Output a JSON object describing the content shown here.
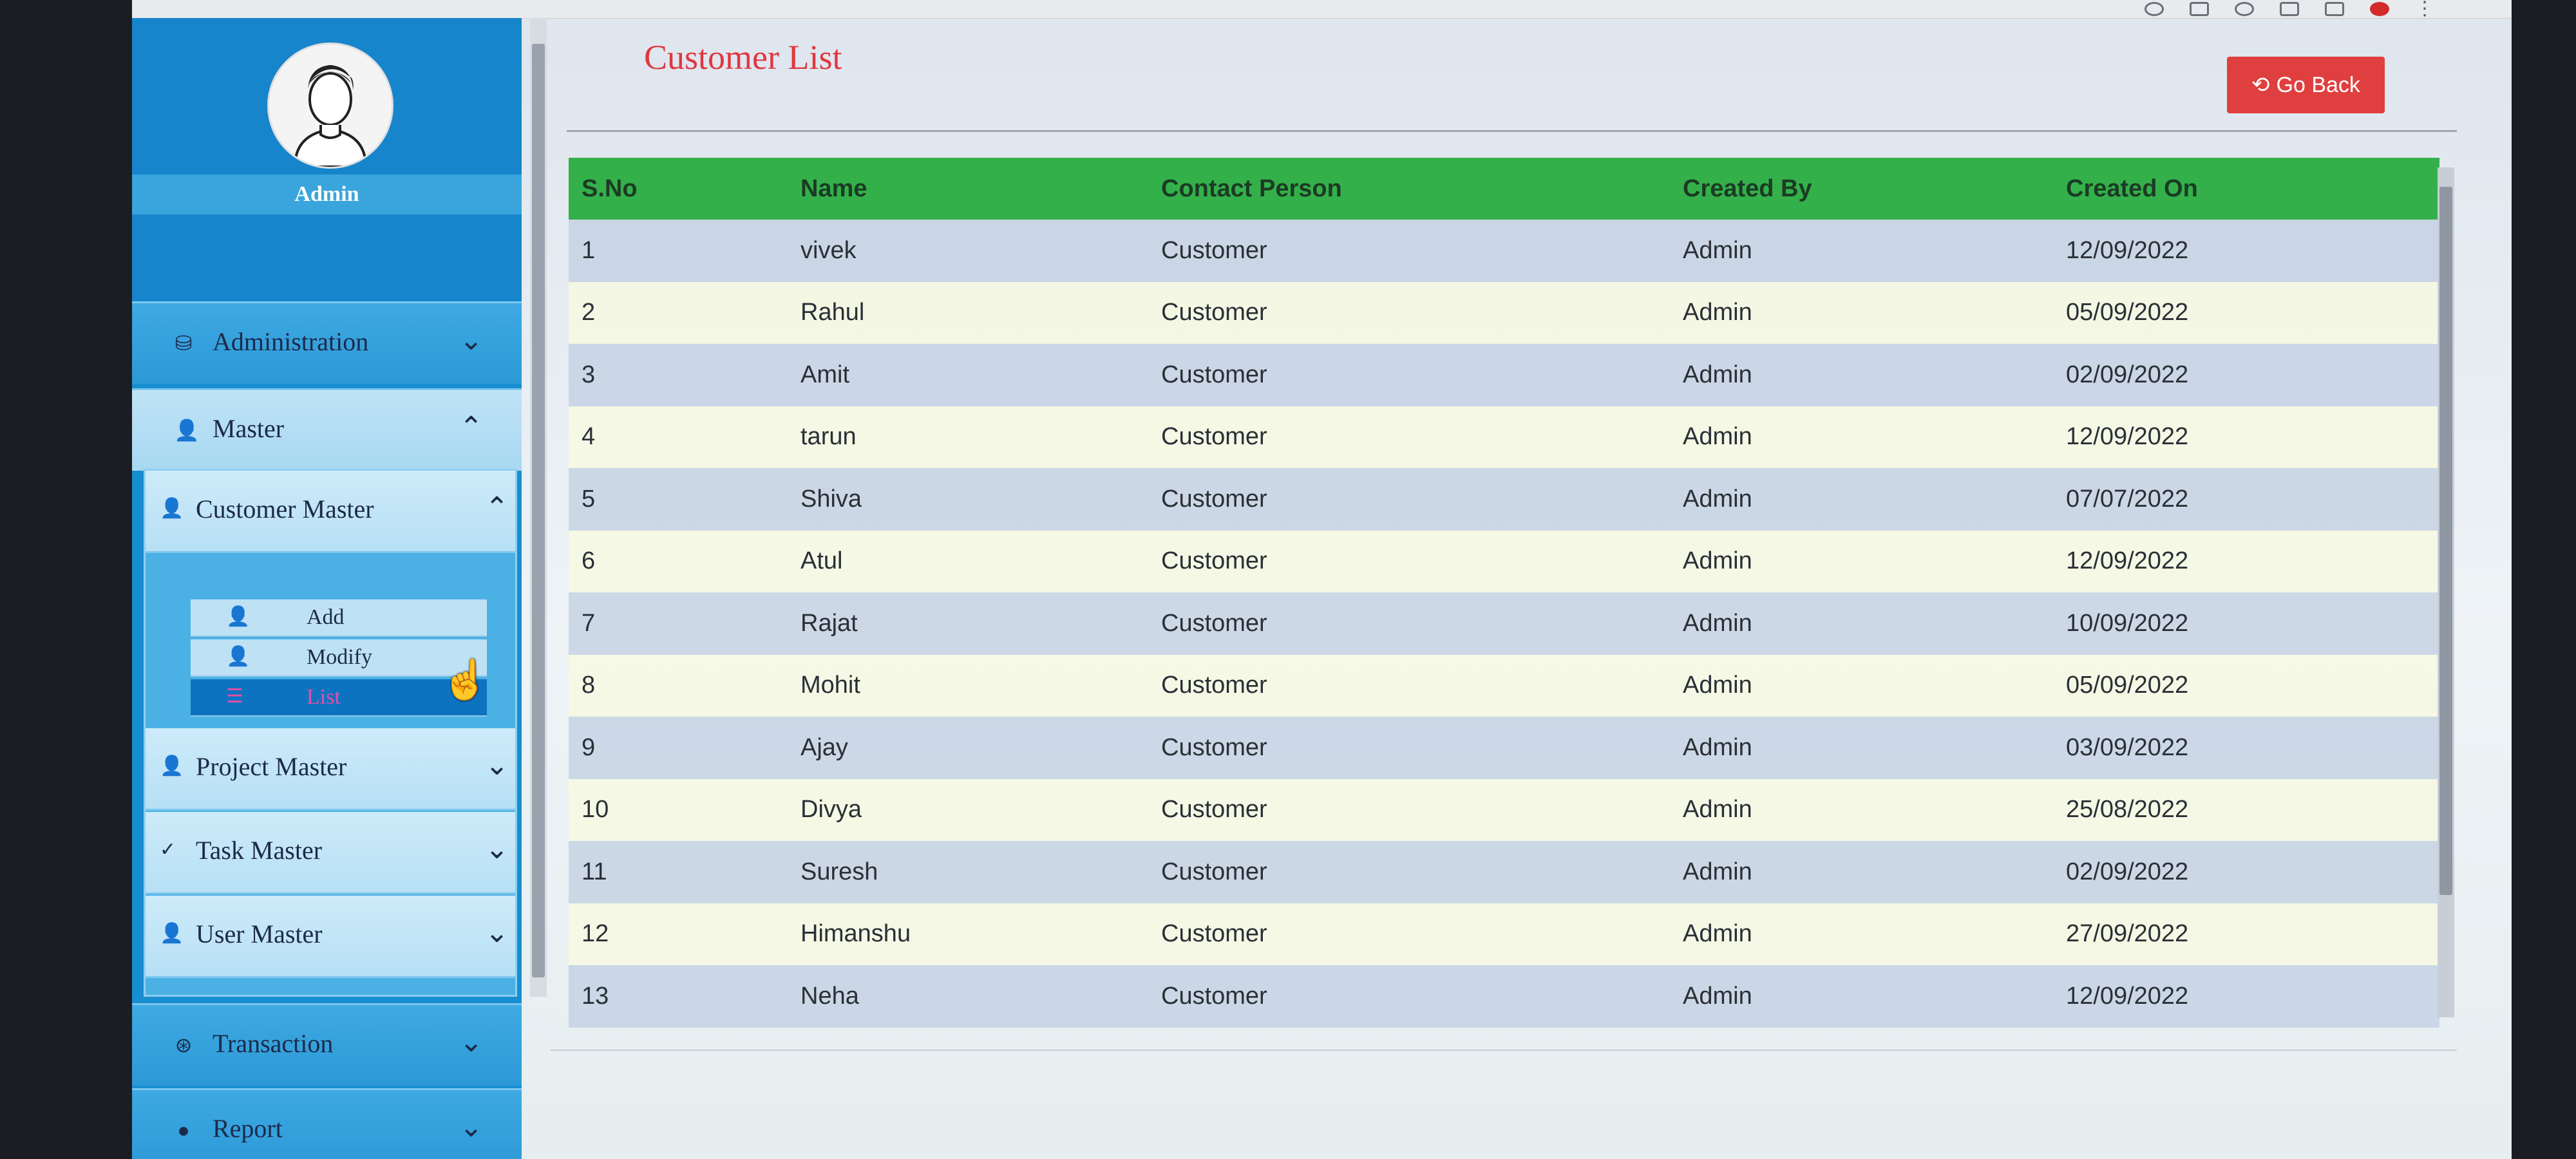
{
  "sidebar": {
    "user_name": "Admin",
    "nav": [
      {
        "label": "Administration",
        "icon": "database-icon",
        "expanded": false
      },
      {
        "label": "Master",
        "icon": "user-icon",
        "expanded": true
      },
      {
        "label": "Transaction",
        "icon": "transaction-icon",
        "expanded": false
      },
      {
        "label": "Report",
        "icon": "alert-icon",
        "expanded": false
      }
    ],
    "master_sub": [
      {
        "label": "Customer Master",
        "expanded": true
      },
      {
        "label": "Project Master",
        "expanded": false
      },
      {
        "label": "Task Master",
        "expanded": false
      },
      {
        "label": "User Master",
        "expanded": false
      }
    ],
    "customer_master_items": [
      {
        "label": "Add",
        "icon": "user-add-icon"
      },
      {
        "label": "Modify",
        "icon": "user-edit-icon"
      },
      {
        "label": "List",
        "icon": "list-icon",
        "active": true
      }
    ]
  },
  "main": {
    "title": "Customer List",
    "go_back_label": "Go Back",
    "table": {
      "headers": [
        "S.No",
        "Name",
        "Contact Person",
        "Created By",
        "Created On"
      ],
      "rows": [
        [
          "1",
          "vivek",
          "Customer",
          "Admin",
          "12/09/2022"
        ],
        [
          "2",
          "Rahul",
          "Customer",
          "Admin",
          "05/09/2022"
        ],
        [
          "3",
          "Amit",
          "Customer",
          "Admin",
          "02/09/2022"
        ],
        [
          "4",
          "tarun",
          "Customer",
          "Admin",
          "12/09/2022"
        ],
        [
          "5",
          "Shiva",
          "Customer",
          "Admin",
          "07/07/2022"
        ],
        [
          "6",
          "Atul",
          "Customer",
          "Admin",
          "12/09/2022"
        ],
        [
          "7",
          "Rajat",
          "Customer",
          "Admin",
          "10/09/2022"
        ],
        [
          "8",
          "Mohit",
          "Customer",
          "Admin",
          "05/09/2022"
        ],
        [
          "9",
          "Ajay",
          "Customer",
          "Admin",
          "03/09/2022"
        ],
        [
          "10",
          "Divya",
          "Customer",
          "Admin",
          "25/08/2022"
        ],
        [
          "11",
          "Suresh",
          "Customer",
          "Admin",
          "02/09/2022"
        ],
        [
          "12",
          "Himanshu",
          "Customer",
          "Admin",
          "27/09/2022"
        ],
        [
          "13",
          "Neha",
          "Customer",
          "Admin",
          "12/09/2022"
        ]
      ]
    }
  },
  "colors": {
    "sidebar": "#178ed0",
    "header_green": "#34b04a",
    "title_red": "#e0373f",
    "button_red": "#e03f3f",
    "active_item": "#0d73c0"
  }
}
